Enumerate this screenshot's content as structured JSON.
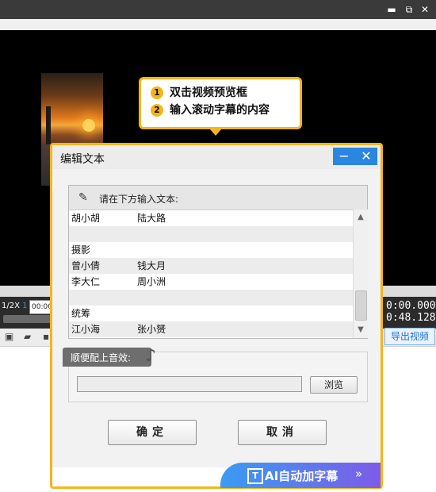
{
  "window": {
    "restore_icon": "restore-icon",
    "close_icon": "close-icon"
  },
  "callout": {
    "steps": [
      {
        "num": "1",
        "text": "双击视频预览框"
      },
      {
        "num": "2",
        "text": "输入滚动字幕的内容"
      }
    ]
  },
  "player": {
    "speed_label": "1/2X",
    "speed_value": "1",
    "time_input": "00:00",
    "time_current": "0:00.000",
    "time_total": "0:48.128",
    "export_label": "导出视频"
  },
  "dialog": {
    "title": "编辑文本",
    "minimize_symbol": "−",
    "close_symbol": "✕",
    "prompt": "请在下方输入文本:",
    "lines": [
      {
        "c1": "胡小胡",
        "c2": "陆大路"
      },
      {
        "c1": "",
        "c2": ""
      },
      {
        "c1": "摄影",
        "c2": ""
      },
      {
        "c1": "曾小倩",
        "c2": "钱大月"
      },
      {
        "c1": "李大仁",
        "c2": "周小洲"
      },
      {
        "c1": "",
        "c2": ""
      },
      {
        "c1": "统筹",
        "c2": ""
      },
      {
        "c1": "江小海",
        "c2": "张小赟"
      }
    ],
    "music_label": "顺便配上音效:",
    "music_path": "",
    "browse_label": "浏览",
    "ok_label": "确定",
    "cancel_label": "取消",
    "ai_label": "AI自动加字幕",
    "ai_chevron": "»"
  },
  "colors": {
    "accent": "#f5b51a",
    "title_button": "#2b86e0",
    "ai_gradient_start": "#3a9bf2",
    "ai_gradient_end": "#7d5ce8"
  }
}
